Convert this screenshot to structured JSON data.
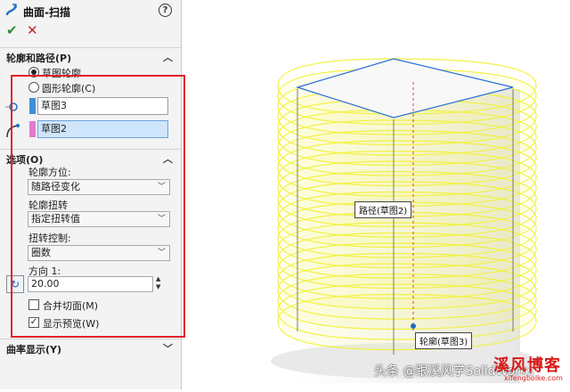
{
  "panel": {
    "title": "曲面-扫描",
    "help": "?",
    "ok": "✔",
    "cancel": "✕",
    "profile_path": {
      "header": "轮廓和路径(P)",
      "options": [
        {
          "label": "草图轮廓",
          "checked": true
        },
        {
          "label": "圆形轮廓(C)",
          "checked": false
        }
      ],
      "profile_value": "草图3",
      "path_value": "草图2",
      "profile_color": "#3f8fd9",
      "path_color": "#e27ad0"
    },
    "options": {
      "header": "选项(O)",
      "orientation_label": "轮廓方位:",
      "orientation_value": "随路径变化",
      "twist_label": "轮廓扭转",
      "twist_value": "指定扭转值",
      "twist_control_label": "扭转控制:",
      "twist_control_value": "圈数",
      "direction_label": "方向 1:",
      "direction_value": "20.00",
      "merge_faces": {
        "label": "合并切面(M)",
        "checked": false
      },
      "show_preview": {
        "label": "显示预览(W)",
        "checked": true
      }
    },
    "curvature_header": "曲率显示(Y)"
  },
  "viewport": {
    "path_callout": "路径(草图2)",
    "profile_callout": "轮廓(草图3)"
  },
  "watermark": {
    "author": "头条 @跟溪风学SolidWorks",
    "blog": "溪风博客",
    "url": "xifengbolke.com"
  },
  "colors": {
    "highlight_frame": "#e0242a",
    "sweep_preview": "#f2f23a",
    "edge_blue": "#2a6fd6"
  }
}
